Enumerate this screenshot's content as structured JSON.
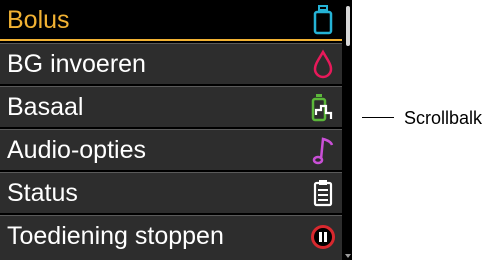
{
  "menu": {
    "items": [
      {
        "label": "Bolus",
        "icon": "insulin-cartridge-icon",
        "icon_color": "#25b3d6",
        "selected": true
      },
      {
        "label": "BG invoeren",
        "icon": "blood-drop-icon",
        "icon_color": "#e8195a",
        "selected": false
      },
      {
        "label": "Basaal",
        "icon": "basal-rate-icon",
        "icon_color": "#5cb83a",
        "selected": false
      },
      {
        "label": "Audio-opties",
        "icon": "music-note-icon",
        "icon_color": "#c94fd6",
        "selected": false
      },
      {
        "label": "Status",
        "icon": "clipboard-icon",
        "icon_color": "#ffffff",
        "selected": false
      },
      {
        "label": "Toediening stoppen",
        "icon": "stop-delivery-icon",
        "icon_color": "#d8282e",
        "selected": false
      }
    ]
  },
  "annotation": {
    "label": "Scrollbalk"
  },
  "colors": {
    "highlight": "#f2b233",
    "row_background": "#2d2d2d",
    "device_background": "#000000"
  }
}
